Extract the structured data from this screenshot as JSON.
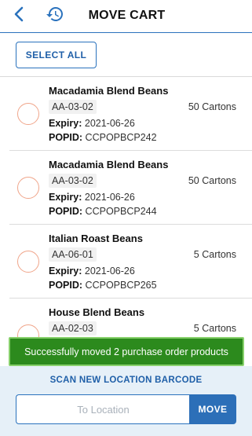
{
  "header": {
    "title": "MOVE CART",
    "back_icon": "chevron-left-icon",
    "history_icon": "history-icon",
    "accent_color": "#2a72bd"
  },
  "toolbar": {
    "select_all_label": "SELECT ALL"
  },
  "labels": {
    "expiry": "Expiry:",
    "popid": "POPID:"
  },
  "items": [
    {
      "name": "Macadamia Blend Beans",
      "location": "AA-03-02",
      "quantity": "50 Cartons",
      "expiry": "2021-06-26",
      "popid": "CCPOPBCP242",
      "selected": false
    },
    {
      "name": "Macadamia Blend Beans",
      "location": "AA-03-02",
      "quantity": "50 Cartons",
      "expiry": "2021-06-26",
      "popid": "CCPOPBCP244",
      "selected": false
    },
    {
      "name": "Italian Roast Beans",
      "location": "AA-06-01",
      "quantity": "5 Cartons",
      "expiry": "2021-06-26",
      "popid": "CCPOPBCP265",
      "selected": false
    },
    {
      "name": "House Blend Beans",
      "location": "AA-02-03",
      "quantity": "5 Cartons",
      "expiry": "",
      "popid": "",
      "selected": false
    }
  ],
  "toast": {
    "message": "Successfully moved 2 purchase order products",
    "color": "#2c8a1d"
  },
  "footer": {
    "scan_label": "SCAN NEW LOCATION BARCODE",
    "location_value": "",
    "location_placeholder": "To Location",
    "move_label": "MOVE"
  }
}
